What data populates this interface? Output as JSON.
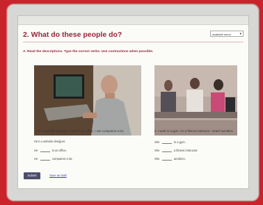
{
  "page": {
    "title": "2. What do these people do?",
    "dropdown_label": "available menu",
    "instruction": "A. Read the descriptions. Type the correct verbs. Use contractions when possible."
  },
  "exercises": [
    {
      "number_text": "1. I'm a website designer. I work in an office. I use computers a lot.",
      "lines": [
        "He's a website designer.",
        "He",
        "in an office.",
        "He",
        "computers a lot."
      ]
    },
    {
      "number_text": "2. I work in a gym. I'm a fitness instructor. I teach aerobics.",
      "lines": [
        "She",
        "in a gym.",
        "She",
        "a fitness instructor.",
        "She",
        "aerobics."
      ]
    }
  ],
  "actions": {
    "submit_label": "Submit",
    "save_label": "Save as draft"
  },
  "colors": {
    "background": "#c9242c",
    "title": "#9b2338",
    "submit": "#4d4d6b"
  }
}
